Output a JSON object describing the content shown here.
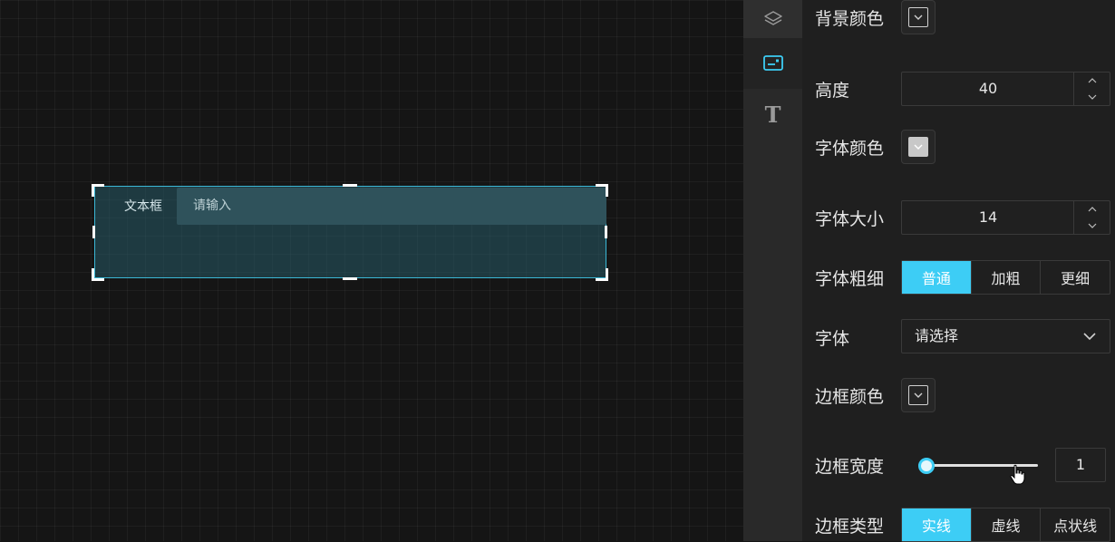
{
  "canvas": {
    "component": {
      "label": "文本框",
      "placeholder": "请输入"
    }
  },
  "tabs": [
    {
      "name": "layers",
      "icon": "layers-icon"
    },
    {
      "name": "style",
      "icon": "card-icon",
      "active": true
    },
    {
      "name": "text",
      "icon": "text-icon",
      "glyph": "T"
    }
  ],
  "panel": {
    "background_color": {
      "label": "背景颜色"
    },
    "height": {
      "label": "高度",
      "value": "40"
    },
    "font_color": {
      "label": "字体颜色",
      "swatch": "#c8c8c8"
    },
    "font_size": {
      "label": "字体大小",
      "value": "14"
    },
    "font_weight": {
      "label": "字体粗细",
      "options": [
        "普通",
        "加粗",
        "更细"
      ],
      "selected": 0
    },
    "font_family": {
      "label": "字体",
      "placeholder": "请选择"
    },
    "border_color": {
      "label": "边框颜色"
    },
    "border_width": {
      "label": "边框宽度",
      "value": "1",
      "min": 1,
      "max": 10
    },
    "border_type": {
      "label": "边框类型",
      "options": [
        "实线",
        "虚线",
        "点状线"
      ],
      "selected": 0
    }
  },
  "colors": {
    "accent": "#3dcdf5",
    "selection_border": "#3bb8d6"
  }
}
